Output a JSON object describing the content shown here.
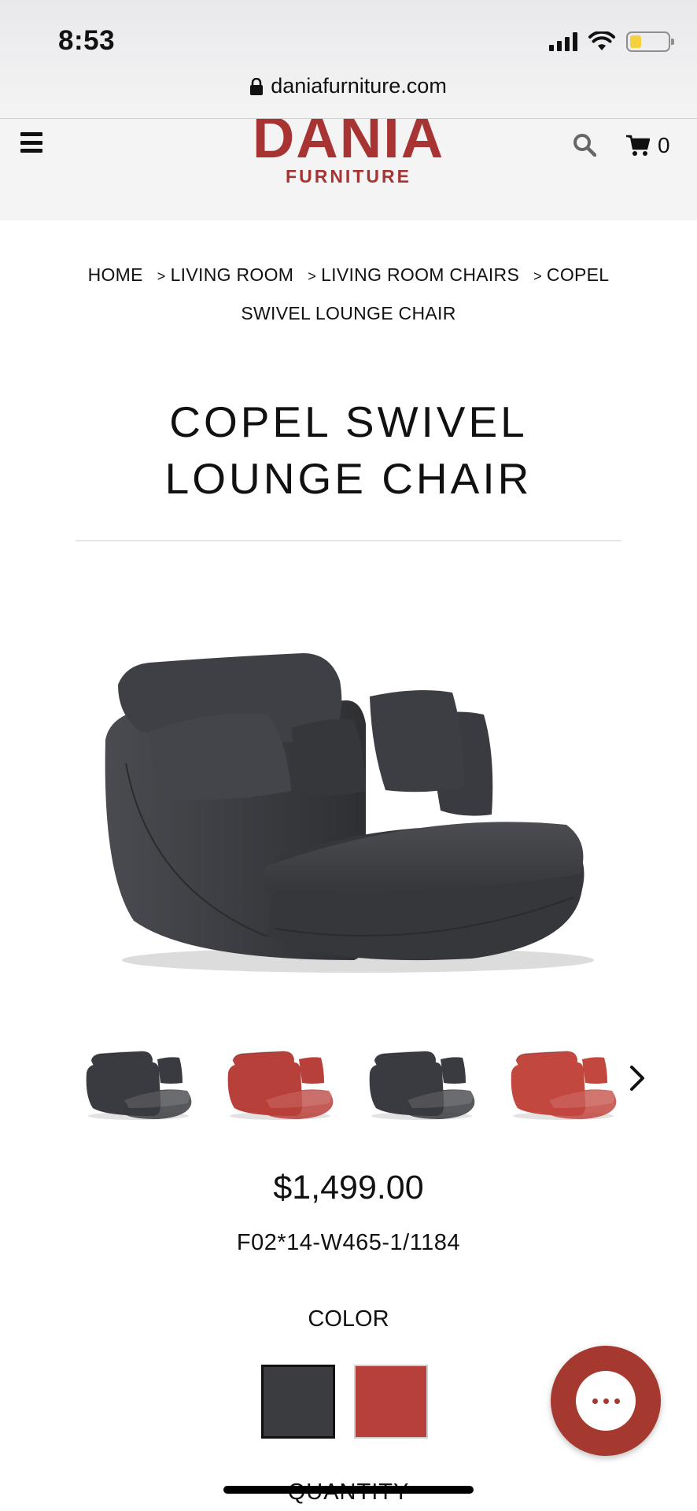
{
  "status_bar": {
    "time": "8:53",
    "icons": [
      "signal-icon",
      "wifi-icon",
      "battery-icon"
    ],
    "battery_level": 0.2
  },
  "browser": {
    "url": "daniafurniture.com",
    "lock_icon": "lock-icon"
  },
  "header": {
    "menu_icon": "hamburger-menu-icon",
    "logo_main": "DANIA",
    "logo_sub": "FURNITURE",
    "search_icon": "search-icon",
    "cart_icon": "cart-icon",
    "cart_count": "0",
    "brand_color": "#a83333"
  },
  "breadcrumb": {
    "items": [
      "HOME",
      "LIVING ROOM",
      "LIVING ROOM CHAIRS",
      "COPEL SWIVEL LOUNGE CHAIR"
    ]
  },
  "product": {
    "title_line1": "COPEL SWIVEL",
    "title_line2": "LOUNGE CHAIR",
    "price": "$1,499.00",
    "sku": "F02*14-W465-1/1184",
    "color_label": "COLOR",
    "quantity_label": "QUANTITY",
    "swatches": [
      {
        "name": "charcoal",
        "color": "#3b3c40",
        "selected": true
      },
      {
        "name": "red",
        "color": "#b8403a",
        "selected": false
      }
    ],
    "thumbnails": [
      {
        "color": "#3a3b40"
      },
      {
        "color": "#b8403a"
      },
      {
        "color": "#3a3b40"
      },
      {
        "color": "#c2473f"
      }
    ],
    "thumb_next_icon": "chevron-right-icon"
  },
  "chat": {
    "icon": "chat-ellipsis-icon",
    "color": "#a5382f"
  }
}
